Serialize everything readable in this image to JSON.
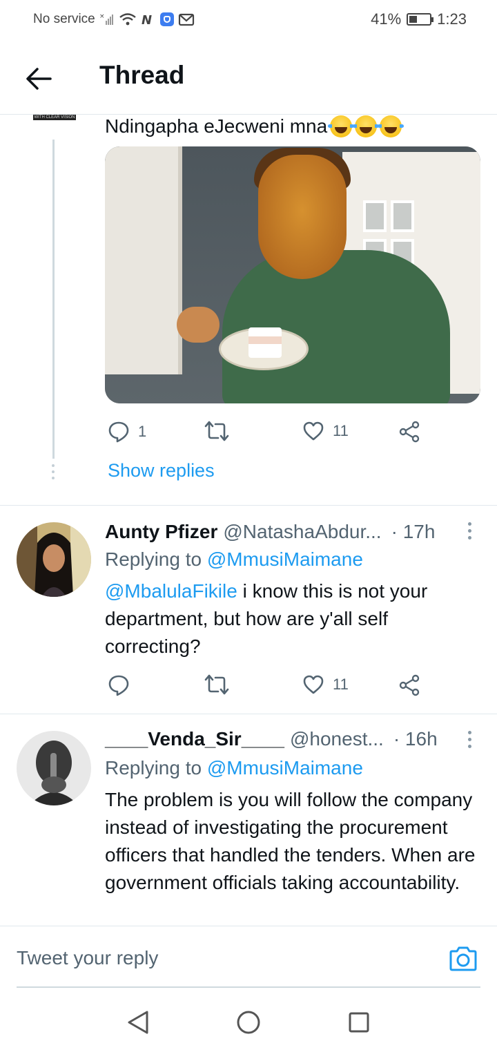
{
  "status_bar": {
    "carrier": "No service",
    "battery": "41%",
    "battery_level": 0.41,
    "time": "1:23"
  },
  "header": {
    "title": "Thread"
  },
  "top_tweet": {
    "avatar_label": "WITH CLEAR VISION",
    "text": "Ndingapha eJecweni mna",
    "emoji_count": 3,
    "reply_count": "1",
    "retweet_count": "",
    "like_count": "11",
    "show_replies": "Show replies"
  },
  "replies": [
    {
      "name": "Aunty Pfizer",
      "handle": "@NatashaAbdur...",
      "time": "· 17h",
      "replying_prefix": "Replying to",
      "replying_to": "@MmusiMaimane",
      "mention": "@MbalulaFikile",
      "body": " i know this is not your department, but how are y'all self correcting?",
      "reply_count": "",
      "retweet_count": "",
      "like_count": "11"
    },
    {
      "name": "____Venda_Sir____",
      "handle": "@honest...",
      "time": "· 16h",
      "replying_prefix": "Replying to",
      "replying_to": "@MmusiMaimane",
      "body": "The problem is you will follow the company instead of investigating the procurement officers that handled the tenders. When are government officials taking accountability."
    }
  ],
  "compose": {
    "placeholder": "Tweet your reply"
  },
  "icons": {
    "back": "arrow-left-icon",
    "reply": "comment-icon",
    "retweet": "retweet-icon",
    "like": "heart-icon",
    "share": "share-icon",
    "camera": "camera-icon"
  },
  "colors": {
    "accent": "#1d9bf0",
    "text": "#0f1419",
    "muted": "#536471"
  }
}
